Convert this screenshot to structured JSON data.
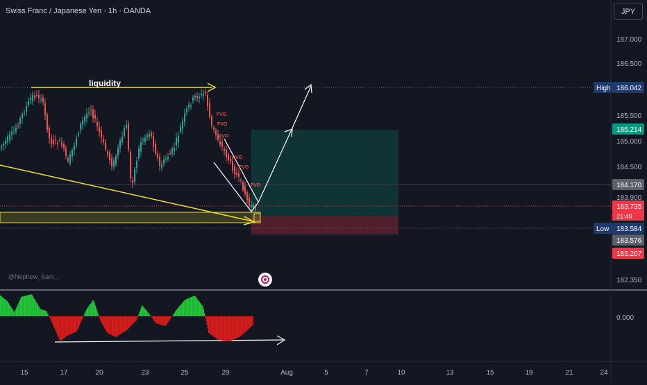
{
  "header": {
    "title": "Swiss Franc / Japanese Yen · 1h · OANDA",
    "currency_button": "JPY"
  },
  "watermark": "@Nephew_Sam_",
  "annotations": {
    "liquidity": "liquidity",
    "fvg_labels": [
      "FVG",
      "FVG",
      "FVG",
      "FVG",
      "FVG",
      "FVG"
    ]
  },
  "price_axis": {
    "ticks": [
      "187.000",
      "186.500",
      "185.500",
      "185.000",
      "184.500",
      "183.900",
      "182.350"
    ],
    "high": {
      "label": "High",
      "value": "186.042"
    },
    "low": {
      "label": "Low",
      "value": "183.584"
    },
    "tags": [
      {
        "value": "185.214",
        "color": "#089981"
      },
      {
        "value": "184.170",
        "color": "#5d606b"
      },
      {
        "value": "183.735",
        "countdown": "21:49",
        "color": "#f23645"
      },
      {
        "value": "183.576",
        "color": "#5d606b"
      },
      {
        "value": "183.207",
        "color": "#f23645"
      }
    ]
  },
  "oscillator_axis": {
    "tick": "0.000"
  },
  "time_axis": {
    "ticks": [
      "15",
      "17",
      "20",
      "23",
      "25",
      "29",
      "Aug",
      "5",
      "7",
      "10",
      "13",
      "15",
      "19",
      "21",
      "24"
    ]
  },
  "colors": {
    "background": "#131722",
    "up": "#26a69a",
    "down": "#ef5350",
    "annotation": "#f0e130",
    "osc_pos": "#22c93a",
    "osc_neg": "#d91c1c",
    "profit": "#089981",
    "loss": "#f23645"
  }
}
